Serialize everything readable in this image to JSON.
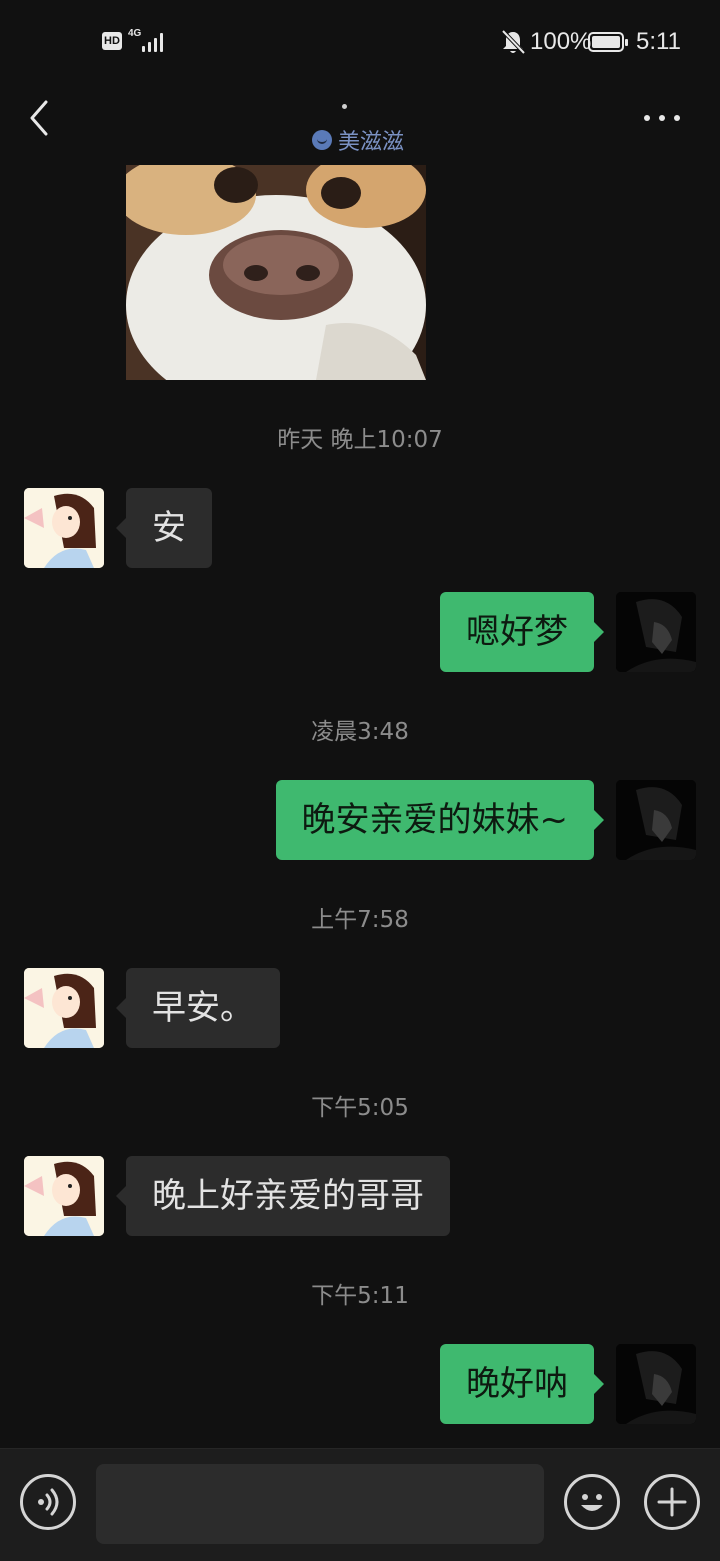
{
  "status_bar": {
    "hd": "HD",
    "network": "4G",
    "battery_text": "100%",
    "battery_level": 1.0,
    "time": "5:11",
    "icons": [
      "signal-icon",
      "mute-bell-icon",
      "battery-icon"
    ]
  },
  "header": {
    "status_icon": "smile-face-icon",
    "status_text": "美滋滋",
    "back_icon": "chevron-left-icon",
    "more_icon": "more-dots-icon"
  },
  "messages": [
    {
      "type": "sticker",
      "from": "self",
      "description_icon": "dog-sticker-image"
    },
    {
      "type": "time",
      "text": "昨天 晚上10:07"
    },
    {
      "type": "text",
      "from": "other",
      "text": "安"
    },
    {
      "type": "text",
      "from": "self",
      "text": "嗯好梦"
    },
    {
      "type": "time",
      "text": "凌晨3:48"
    },
    {
      "type": "text",
      "from": "self",
      "text": "晚安亲爱的妹妹~"
    },
    {
      "type": "time",
      "text": "上午7:58"
    },
    {
      "type": "text",
      "from": "other",
      "text": "早安。"
    },
    {
      "type": "time",
      "text": "下午5:05"
    },
    {
      "type": "text",
      "from": "other",
      "text": "晚上好亲爱的哥哥"
    },
    {
      "type": "time",
      "text": "下午5:11"
    },
    {
      "type": "text",
      "from": "self",
      "text": "晚好呐"
    }
  ],
  "input_bar": {
    "voice_icon": "voice-icon",
    "input_value": "",
    "emoji_icon": "emoji-icon",
    "plus_icon": "plus-icon"
  },
  "colors": {
    "background": "#111111",
    "bubble_in": "#2c2c2c",
    "bubble_out": "#3fb96f",
    "timestamp": "#8c8c8c"
  }
}
